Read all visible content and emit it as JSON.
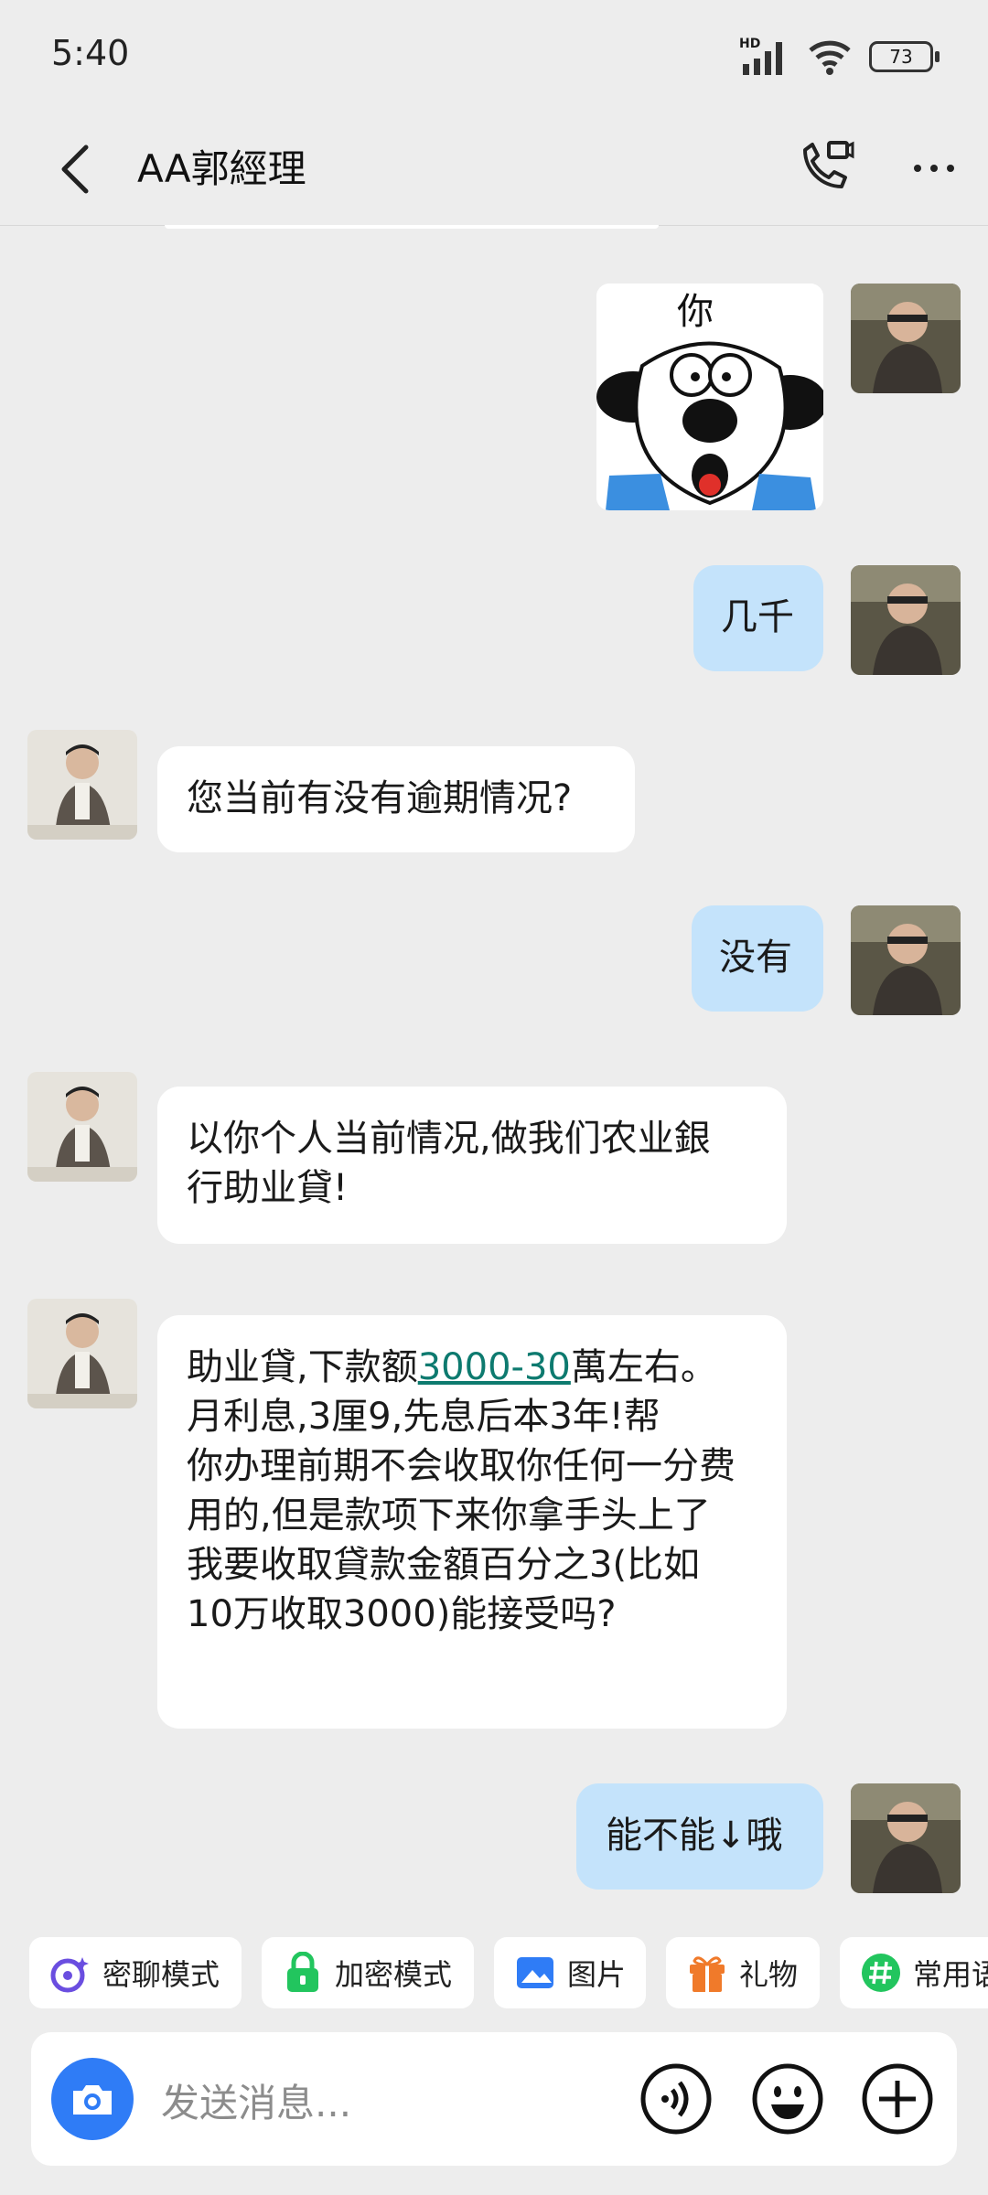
{
  "status_bar": {
    "time": "5:40",
    "network": "HD",
    "battery": "73"
  },
  "header": {
    "title": "AA郭經理"
  },
  "messages": [
    {
      "from": "me",
      "type": "sticker",
      "text": "你"
    },
    {
      "from": "me",
      "text": "几千"
    },
    {
      "from": "them",
      "text": "您当前有没有逾期情况?"
    },
    {
      "from": "me",
      "text": "没有"
    },
    {
      "from": "them",
      "lines": [
        "以你个人当前情况,做我们农业銀",
        "行助业貸!"
      ]
    },
    {
      "from": "them",
      "prefix": "助业貸,下款额",
      "link": "3000-30",
      "suffix": "萬左右。",
      "lines": [
        "月利息,3厘9,先息后本3年!帮",
        "你办理前期不会收取你任何一分费",
        "用的,但是款项下来你拿手头上了",
        "我要收取貸款金額百分之3(比如",
        "10万收取3000)能接受吗?"
      ]
    },
    {
      "from": "me",
      "text": "能不能↓哦"
    }
  ],
  "quick_actions": [
    {
      "label": "密聊模式",
      "icon": "secret-chat-icon"
    },
    {
      "label": "加密模式",
      "icon": "lock-icon"
    },
    {
      "label": "图片",
      "icon": "image-icon"
    },
    {
      "label": "礼物",
      "icon": "gift-icon"
    },
    {
      "label": "常用语",
      "icon": "hashtag-icon"
    }
  ],
  "input": {
    "placeholder": "发送消息..."
  },
  "colors": {
    "my_bubble": "#c4e3fb",
    "their_bubble": "#ffffff",
    "link": "#0d7a6f",
    "camera": "#2f7cf6"
  }
}
